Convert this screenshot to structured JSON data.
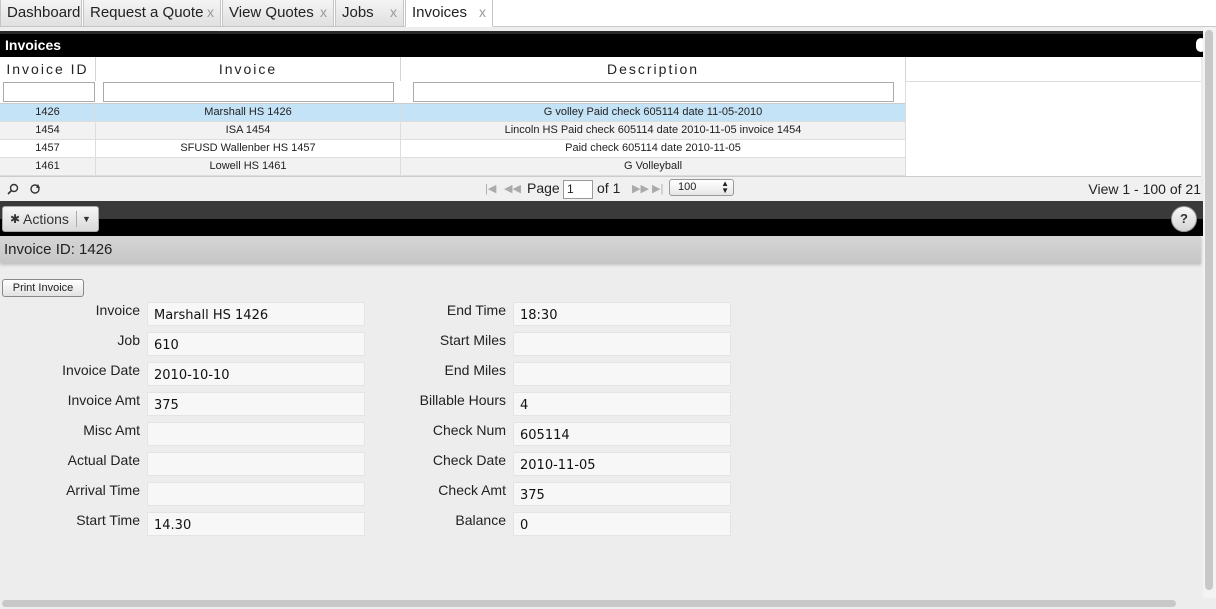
{
  "tabs": [
    {
      "label": "Dashboard",
      "closable": false
    },
    {
      "label": "Request a Quote",
      "closable": true
    },
    {
      "label": "View Quotes",
      "closable": true
    },
    {
      "label": "Jobs",
      "closable": true
    },
    {
      "label": "Invoices",
      "closable": true,
      "active": true
    }
  ],
  "close_glyph": "x",
  "grid": {
    "title": "Invoices",
    "columns": [
      "Invoice ID",
      "Invoice",
      "Description"
    ],
    "rows": [
      {
        "id": "1426",
        "invoice": "Marshall HS 1426",
        "description": "G volley Paid check 605114 date 11-05-2010",
        "selected": true
      },
      {
        "id": "1454",
        "invoice": "ISA  1454",
        "description": "Lincoln HS Paid check 605114 date 2010-11-05 invoice 1454"
      },
      {
        "id": "1457",
        "invoice": "SFUSD Wallenber HS  1457",
        "description": "Paid check 605114 date 2010-11-05"
      },
      {
        "id": "1461",
        "invoice": "Lowell HS 1461",
        "description": "G Volleyball"
      }
    ]
  },
  "pager": {
    "page_label": "Page",
    "page_value": "1",
    "of_label": "of 1",
    "rows_per_page": "100",
    "view_text": "View 1 - 100 of 21"
  },
  "actions": {
    "label": "Actions",
    "help": "?"
  },
  "detail": {
    "header": "Invoice ID: 1426",
    "print_label": "Print Invoice",
    "left_fields": [
      {
        "label": "Invoice",
        "value": "Marshall HS 1426"
      },
      {
        "label": "Job",
        "value": "610"
      },
      {
        "label": "Invoice Date",
        "value": "2010-10-10"
      },
      {
        "label": "Invoice Amt",
        "value": "375"
      },
      {
        "label": "Misc Amt",
        "value": ""
      },
      {
        "label": "Actual Date",
        "value": ""
      },
      {
        "label": "Arrival Time",
        "value": ""
      },
      {
        "label": "Start Time",
        "value": "14.30"
      }
    ],
    "right_fields": [
      {
        "label": "End Time",
        "value": "18:30"
      },
      {
        "label": "Start Miles",
        "value": ""
      },
      {
        "label": "End Miles",
        "value": ""
      },
      {
        "label": "Billable Hours",
        "value": "4"
      },
      {
        "label": "Check Num",
        "value": "605114"
      },
      {
        "label": "Check Date",
        "value": "2010-11-05"
      },
      {
        "label": "Check Amt",
        "value": "375"
      },
      {
        "label": "Balance",
        "value": "0"
      }
    ]
  }
}
